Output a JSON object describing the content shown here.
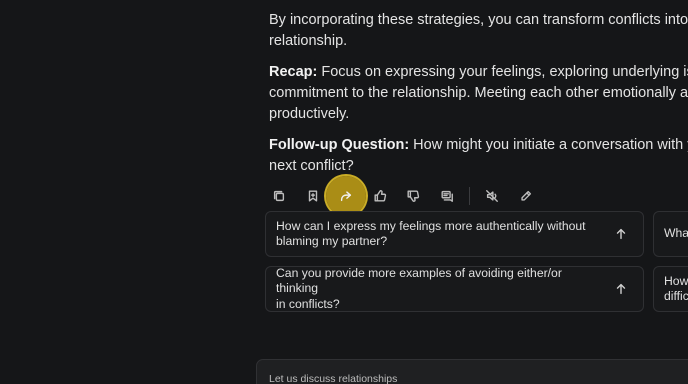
{
  "message": {
    "p1": "By incorporating these strategies, you can transform conflicts into oppo",
    "p1b": "relationship.",
    "recap_label": "Recap:",
    "recap_text": " Focus on expressing your feelings, exploring underlying issues, t",
    "recap_line2": "commitment to the relationship. Meeting each other emotionally and av",
    "recap_line3": "productively.",
    "followup_label": "Follow-up Question:",
    "followup_text": " How might you initiate a conversation with your par",
    "followup_line2": "next conflict?"
  },
  "actions": [
    {
      "icon": "copy-icon"
    },
    {
      "icon": "bookmark-icon"
    },
    {
      "icon": "share-icon"
    },
    {
      "icon": "thumbs-up-icon"
    },
    {
      "icon": "thumbs-down-icon"
    },
    {
      "icon": "comment-icon"
    },
    {
      "icon": "no-sound-icon"
    },
    {
      "icon": "edit-icon"
    }
  ],
  "suggestions": [
    {
      "line1": "How can I express my feelings more authentically without",
      "line2": "blaming my partner?"
    },
    {
      "line1": "Can you provide more examples of avoiding either/or thinking",
      "line2": "in conflicts?"
    },
    {
      "line1": "What",
      "line2": ""
    },
    {
      "line1": "How",
      "line2": "diffic"
    }
  ],
  "composer": {
    "value": "Let us discuss relationships"
  },
  "colors": {
    "background": "#151618",
    "highlight": "#c4a216"
  }
}
